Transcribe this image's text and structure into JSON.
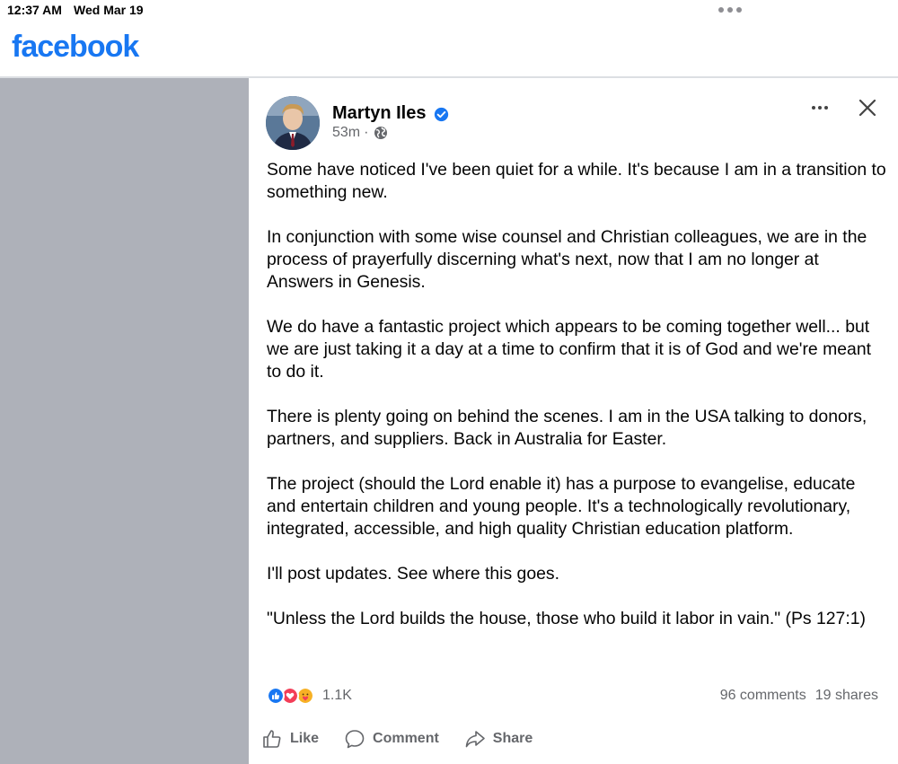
{
  "status_bar": {
    "time": "12:37 AM",
    "date": "Wed Mar 19"
  },
  "header": {
    "logo_text": "facebook",
    "brand_color": "#1877f2"
  },
  "post": {
    "author": "Martyn Iles",
    "verified": true,
    "time_ago": "53m",
    "separator": "·",
    "audience_icon": "globe-icon",
    "paragraphs": [
      "Some have noticed I've been quiet for a while. It's because I am in a transition to something new.",
      "In conjunction with some wise counsel and Christian colleagues, we are in the process of prayerfully discerning what's next, now that I am no longer at Answers in Genesis.",
      "We do have a fantastic project which appears to be coming together well... but we are just taking it a day at a time to confirm that it is of God and we're meant to do it.",
      "There is plenty going on behind the scenes. I am in the USA talking to donors, partners, and suppliers. Back in Australia for Easter.",
      "The project (should the Lord enable it) has a purpose to evangelise, educate and entertain children and young people. It's a technologically revolutionary, integrated, accessible, and high quality Christian education platform.",
      "I'll post updates. See where this goes.",
      "\"Unless the Lord builds the house, those who build it labor in vain.\" (Ps 127:1)"
    ],
    "reactions": {
      "icons": [
        "like-reaction-icon",
        "love-reaction-icon",
        "care-reaction-icon"
      ],
      "count": "1.1K"
    },
    "comments": "96 comments",
    "shares": "19 shares",
    "actions": {
      "like": "Like",
      "comment": "Comment",
      "share": "Share"
    }
  }
}
